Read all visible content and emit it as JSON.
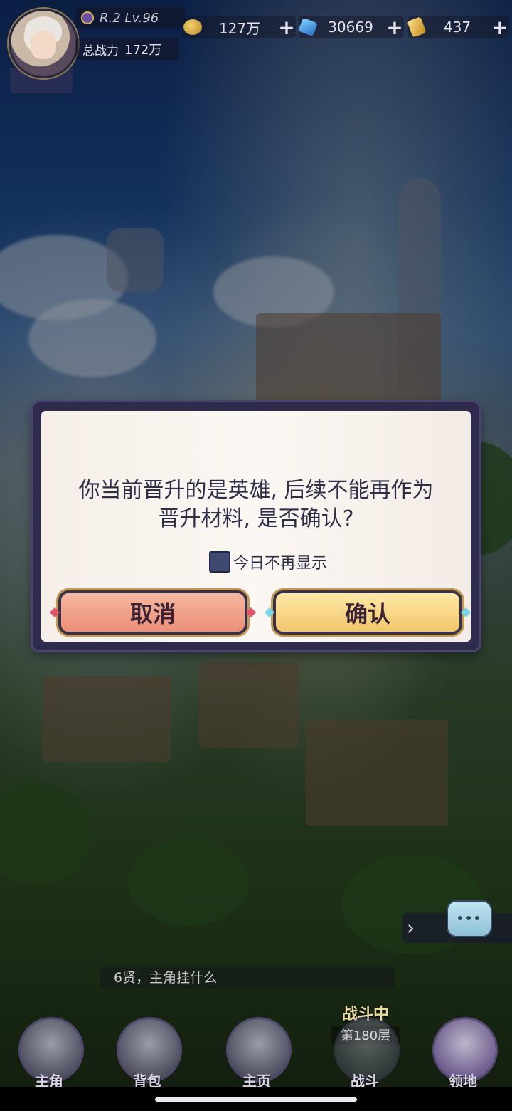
{
  "header": {
    "level_text": "R.2 Lv.96",
    "power_label": "总战力",
    "power_value": "172万",
    "currencies": [
      {
        "icon": "coin-icon",
        "value": "127万"
      },
      {
        "icon": "crystal-icon",
        "value": "30669"
      },
      {
        "icon": "gold-bar-icon",
        "value": "437"
      }
    ],
    "plus_symbol": "+"
  },
  "dialog": {
    "message_line1": "你当前晋升的是英雄, 后续不能再作为",
    "message_line2": "晋升材料, 是否确认?",
    "checkbox_label": "今日不再显示",
    "cancel_label": "取消",
    "confirm_label": "确认"
  },
  "chat": {
    "latest_message": "6贤，主角挂什么"
  },
  "battle": {
    "status": "战斗中",
    "floor": "第180层"
  },
  "nav": {
    "items": [
      {
        "label": "主角"
      },
      {
        "label": "背包"
      },
      {
        "label": "主页"
      },
      {
        "label": "战斗"
      },
      {
        "label": "领地"
      }
    ]
  },
  "colors": {
    "dialog_frame": "#2e2b4d",
    "cancel_button": "#ec8f78",
    "confirm_button": "#f3c66b",
    "text_dark": "#2f2f4a"
  }
}
